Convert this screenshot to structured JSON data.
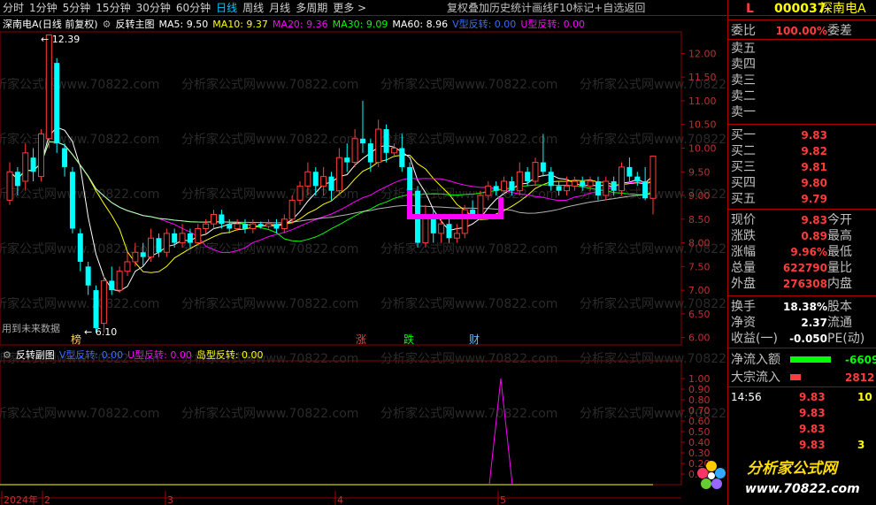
{
  "toolbar": {
    "items": [
      "分时",
      "1分钟",
      "5分钟",
      "15分钟",
      "30分钟",
      "60分钟",
      "日线",
      "周线",
      "月线",
      "多周期",
      "更多 >"
    ],
    "active_index": 6,
    "right_items": [
      "复权",
      "叠加",
      "历史",
      "统计",
      "画线",
      "F10",
      "标记",
      "+自选",
      "返回"
    ]
  },
  "stock_header": {
    "flag": "L",
    "code": "000037",
    "name": "深南电A"
  },
  "main_legend": {
    "title": "深南电A(日线 前复权)",
    "indicator_name": "反转主图",
    "ma5": "MA5: 9.50",
    "ma10": "MA10: 9.37",
    "ma20": "MA20: 9.36",
    "ma30": "MA30: 9.09",
    "ma60": "MA60: 8.96",
    "v_label": "V型反转: 0.00",
    "u_label": "U型反转: 0.00"
  },
  "sub_legend": {
    "indicator_name": "反转副图",
    "v_label": "V型反转: 0.00",
    "u_label": "U型反转: 0.00",
    "island_label": "岛型反转: 0.00"
  },
  "annotations": {
    "high_label": "12.39",
    "low_label": "6.10",
    "future_data": "用到未来数据",
    "tag_bang": "榜",
    "tag_zhang": "涨",
    "tag_die": "跌",
    "tag_cai": "财"
  },
  "watermark": "分析家公式网www.70822.com",
  "x_axis": [
    "2024年",
    "2",
    "3",
    "4",
    "5"
  ],
  "main_y_ticks": [
    "12.00",
    "11.50",
    "11.00",
    "10.50",
    "10.00",
    "9.50",
    "9.00",
    "8.50",
    "8.00",
    "7.50",
    "7.00",
    "6.50",
    "6.00"
  ],
  "sub_y_ticks": [
    "1.00",
    "0.90",
    "0.80",
    "0.70",
    "0.60",
    "0.50",
    "0.40",
    "0.30",
    "0.20",
    "0.10"
  ],
  "order_book": {
    "weibi_label": "委比",
    "weibi_value": "100.00%",
    "weicha_label": "委差",
    "sells": [
      {
        "label": "卖五",
        "price": ""
      },
      {
        "label": "卖四",
        "price": ""
      },
      {
        "label": "卖三",
        "price": ""
      },
      {
        "label": "卖二",
        "price": ""
      },
      {
        "label": "卖一",
        "price": ""
      }
    ],
    "buys": [
      {
        "label": "买一",
        "price": "9.83"
      },
      {
        "label": "买二",
        "price": "9.82"
      },
      {
        "label": "买三",
        "price": "9.81"
      },
      {
        "label": "买四",
        "price": "9.80"
      },
      {
        "label": "买五",
        "price": "9.79"
      }
    ]
  },
  "quote": [
    {
      "label": "现价",
      "value": "9.83",
      "label2": "今开"
    },
    {
      "label": "涨跌",
      "value": "0.89",
      "label2": "最高"
    },
    {
      "label": "涨幅",
      "value": "9.96%",
      "label2": "最低"
    },
    {
      "label": "总量",
      "value": "622790",
      "label2": "量比"
    },
    {
      "label": "外盘",
      "value": "276308",
      "label2": "内盘"
    }
  ],
  "fundamentals": [
    {
      "label": "换手",
      "value": "18.38%",
      "label2": "股本"
    },
    {
      "label": "净资",
      "value": "2.37",
      "label2": "流通"
    },
    {
      "label": "收益(一)",
      "value": "-0.050",
      "label2": "PE(动)"
    }
  ],
  "flows": [
    {
      "label": "净流入额",
      "value": "-6609",
      "color": "#00ff00"
    },
    {
      "label": "大宗流入",
      "value": "2812",
      "color": "#ff3c3c"
    }
  ],
  "ticks": {
    "time": "14:56",
    "rows": [
      {
        "price": "9.83",
        "vol": "10"
      },
      {
        "price": "9.83",
        "vol": ""
      },
      {
        "price": "9.83",
        "vol": ""
      },
      {
        "price": "9.83",
        "vol": "3"
      }
    ]
  },
  "logo": {
    "name": "分析家公式网",
    "url": "www.70822.com"
  },
  "chart_data": {
    "type": "candlestick",
    "ylim": [
      5.9,
      12.4
    ],
    "candles": [
      [
        8.9,
        9.5,
        8.8,
        9.7
      ],
      [
        9.5,
        9.2,
        9.0,
        9.6
      ],
      [
        9.3,
        9.9,
        9.1,
        10.1
      ],
      [
        9.8,
        9.5,
        9.3,
        10.0
      ],
      [
        9.4,
        10.3,
        9.3,
        10.4
      ],
      [
        10.2,
        12.39,
        10.0,
        12.39
      ],
      [
        11.8,
        10.1,
        9.9,
        11.9
      ],
      [
        10.0,
        9.6,
        9.4,
        10.1
      ],
      [
        9.5,
        8.3,
        8.2,
        9.6
      ],
      [
        8.2,
        7.6,
        7.4,
        8.3
      ],
      [
        7.5,
        7.1,
        6.9,
        7.6
      ],
      [
        7.0,
        6.2,
        6.1,
        7.1
      ],
      [
        6.3,
        7.2,
        6.1,
        7.3
      ],
      [
        7.2,
        7.0,
        6.9,
        7.5
      ],
      [
        7.0,
        7.4,
        6.95,
        7.5
      ],
      [
        7.4,
        7.6,
        7.3,
        7.8
      ],
      [
        7.6,
        7.8,
        7.5,
        8.0
      ],
      [
        7.8,
        7.7,
        7.5,
        8.0
      ],
      [
        7.7,
        8.1,
        7.6,
        8.3
      ],
      [
        8.1,
        7.8,
        7.7,
        8.2
      ],
      [
        7.8,
        8.2,
        7.7,
        8.3
      ],
      [
        8.2,
        8.0,
        7.9,
        8.3
      ],
      [
        8.0,
        8.2,
        7.9,
        8.4
      ],
      [
        8.2,
        8.0,
        7.9,
        8.3
      ],
      [
        8.0,
        8.3,
        7.95,
        8.4
      ],
      [
        8.3,
        8.4,
        8.2,
        8.5
      ],
      [
        8.4,
        8.6,
        8.3,
        8.7
      ],
      [
        8.6,
        8.4,
        8.3,
        8.7
      ],
      [
        8.4,
        8.3,
        8.2,
        8.5
      ],
      [
        8.3,
        8.4,
        8.25,
        8.5
      ],
      [
        8.4,
        8.3,
        8.2,
        8.5
      ],
      [
        8.3,
        8.4,
        8.2,
        8.5
      ],
      [
        8.4,
        8.35,
        8.3,
        8.45
      ],
      [
        8.35,
        8.4,
        8.3,
        8.5
      ],
      [
        8.4,
        8.3,
        8.2,
        8.5
      ],
      [
        8.3,
        8.5,
        8.2,
        8.6
      ],
      [
        8.5,
        8.9,
        8.4,
        9.0
      ],
      [
        8.9,
        9.2,
        8.8,
        9.3
      ],
      [
        9.2,
        9.5,
        9.0,
        9.7
      ],
      [
        9.5,
        9.2,
        9.0,
        9.6
      ],
      [
        9.2,
        9.4,
        9.0,
        9.6
      ],
      [
        9.4,
        9.1,
        8.9,
        9.5
      ],
      [
        9.1,
        9.8,
        9.0,
        10.0
      ],
      [
        9.8,
        9.7,
        9.5,
        10.1
      ],
      [
        9.7,
        10.2,
        9.6,
        10.4
      ],
      [
        10.2,
        10.1,
        9.9,
        11.0
      ],
      [
        10.1,
        9.7,
        9.5,
        10.2
      ],
      [
        9.7,
        10.4,
        9.6,
        10.6
      ],
      [
        10.4,
        9.9,
        9.7,
        10.5
      ],
      [
        9.9,
        10.0,
        9.8,
        10.1
      ],
      [
        10.0,
        9.6,
        9.5,
        10.3
      ],
      [
        9.6,
        9.1,
        8.9,
        9.7
      ],
      [
        9.1,
        8.0,
        7.9,
        9.2
      ],
      [
        8.0,
        8.6,
        7.9,
        8.8
      ],
      [
        8.6,
        8.2,
        8.0,
        8.7
      ],
      [
        8.2,
        8.4,
        8.0,
        8.5
      ],
      [
        8.4,
        8.1,
        8.0,
        8.5
      ],
      [
        8.1,
        8.2,
        8.0,
        8.4
      ],
      [
        8.2,
        8.7,
        8.1,
        8.8
      ],
      [
        8.7,
        8.6,
        8.5,
        8.9
      ],
      [
        8.6,
        9.0,
        8.5,
        9.1
      ],
      [
        9.0,
        9.2,
        8.9,
        9.3
      ],
      [
        9.2,
        9.1,
        9.0,
        9.3
      ],
      [
        9.1,
        9.3,
        9.0,
        9.4
      ],
      [
        9.3,
        9.1,
        9.0,
        9.4
      ],
      [
        9.1,
        9.5,
        9.0,
        9.7
      ],
      [
        9.5,
        9.3,
        9.2,
        9.6
      ],
      [
        9.3,
        9.7,
        9.2,
        9.8
      ],
      [
        9.7,
        9.5,
        9.4,
        10.3
      ],
      [
        9.5,
        9.2,
        9.1,
        9.6
      ],
      [
        9.2,
        9.1,
        9.0,
        9.3
      ],
      [
        9.1,
        9.2,
        9.0,
        9.4
      ],
      [
        9.2,
        9.3,
        9.1,
        9.4
      ],
      [
        9.3,
        9.2,
        9.1,
        9.4
      ],
      [
        9.2,
        9.3,
        9.1,
        9.4
      ],
      [
        9.3,
        9.0,
        8.9,
        9.4
      ],
      [
        9.0,
        9.3,
        8.9,
        9.4
      ],
      [
        9.3,
        9.1,
        9.0,
        9.4
      ],
      [
        9.1,
        9.6,
        9.0,
        9.7
      ],
      [
        9.6,
        9.4,
        9.3,
        9.8
      ],
      [
        9.4,
        9.3,
        9.2,
        9.5
      ],
      [
        9.3,
        8.94,
        8.9,
        9.6
      ],
      [
        8.94,
        9.83,
        8.6,
        9.83
      ]
    ]
  }
}
